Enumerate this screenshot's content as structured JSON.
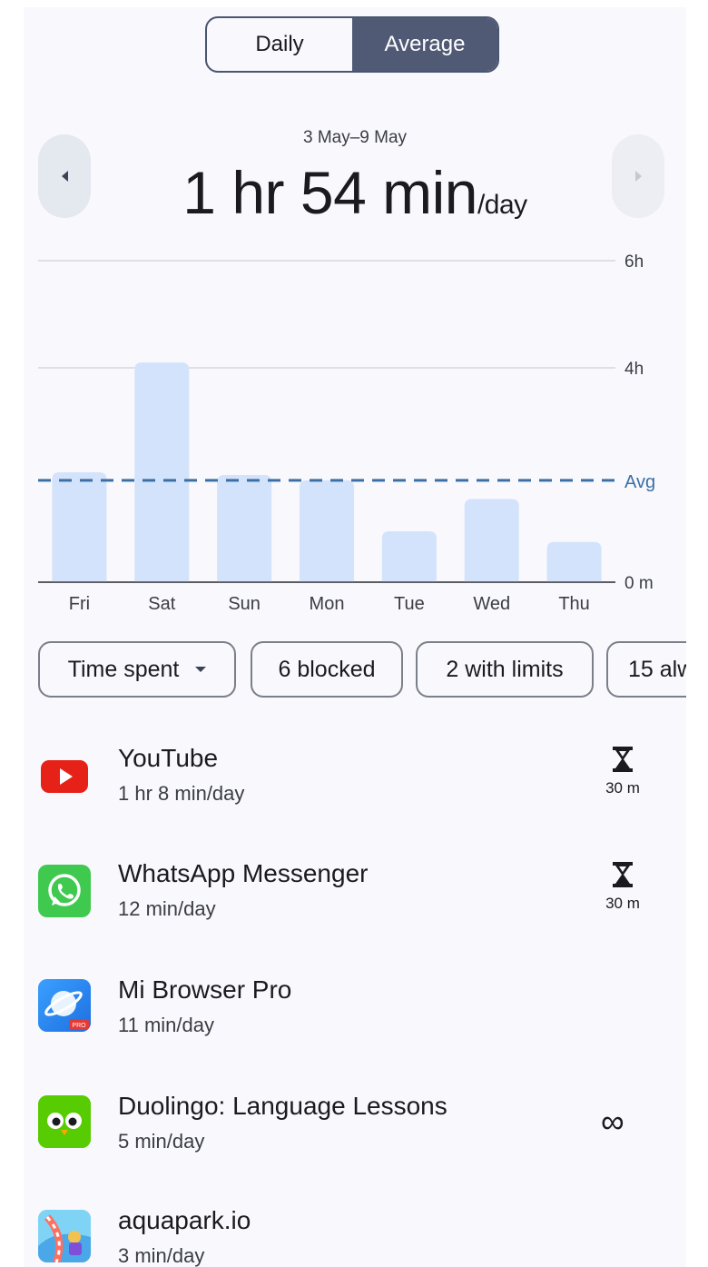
{
  "toggle": {
    "daily": "Daily",
    "average": "Average",
    "selected": "Average"
  },
  "period": {
    "range": "3 May–9 May",
    "total": "1 hr 54 min",
    "unit": "/day"
  },
  "chart_data": {
    "type": "bar",
    "categories": [
      "Fri",
      "Sat",
      "Sun",
      "Mon",
      "Tue",
      "Wed",
      "Thu"
    ],
    "values": [
      2.05,
      4.1,
      2.0,
      1.9,
      0.95,
      1.55,
      0.75
    ],
    "average": 1.9,
    "average_label": "Avg",
    "y_ticks": [
      {
        "value": 6,
        "label": "6h"
      },
      {
        "value": 4,
        "label": "4h"
      },
      {
        "value": 0,
        "label": "0 m"
      }
    ],
    "ylim": [
      0,
      6
    ],
    "units": "hours",
    "grid": true,
    "colors": {
      "bar": "#d3e3fb",
      "avg_line": "#3b6fa5",
      "grid": "#e0e0e4",
      "axis": "#45474d"
    }
  },
  "chips": [
    {
      "label": "Time spent",
      "dropdown": true
    },
    {
      "label": "6 blocked"
    },
    {
      "label": "2 with limits"
    },
    {
      "label": "15 alw"
    }
  ],
  "apps": [
    {
      "name": "YouTube",
      "usage": "1 hr 8 min/day",
      "icon": "youtube-icon",
      "limit": "30 m"
    },
    {
      "name": "WhatsApp Messenger",
      "usage": "12 min/day",
      "icon": "whatsapp-icon",
      "limit": "30 m"
    },
    {
      "name": "Mi Browser Pro",
      "usage": "11 min/day",
      "icon": "mi-browser-icon",
      "badge": "PRO"
    },
    {
      "name": "Duolingo: Language Lessons",
      "usage": "5 min/day",
      "icon": "duolingo-icon",
      "always_allowed": "∞"
    },
    {
      "name": "aquapark.io",
      "usage": "3 min/day",
      "icon": "aquapark-icon"
    }
  ]
}
